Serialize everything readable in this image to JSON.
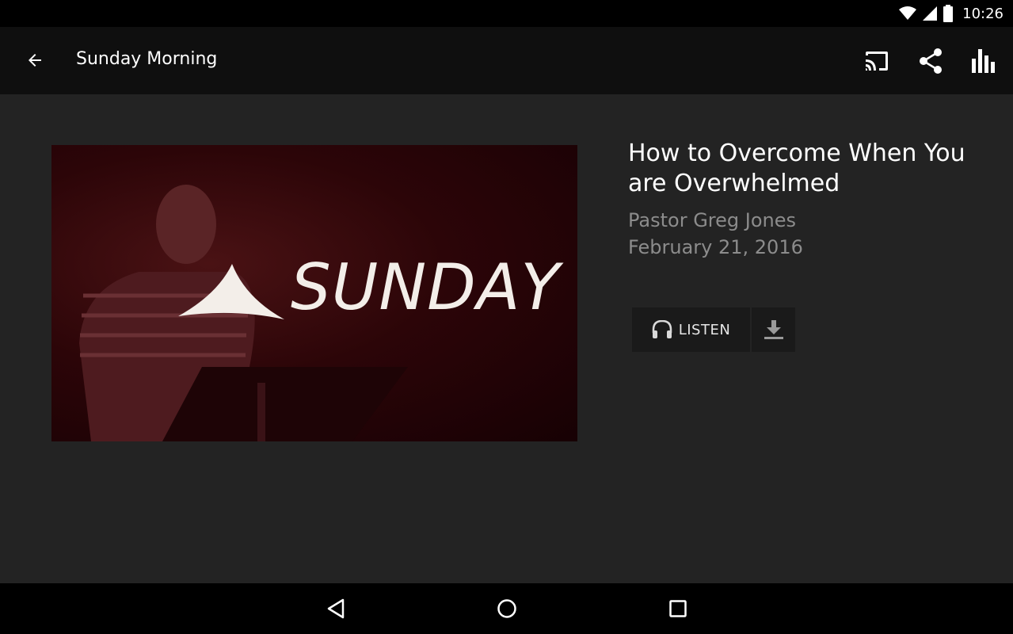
{
  "status_bar": {
    "time": "10:26"
  },
  "app_bar": {
    "title": "Sunday Morning",
    "icons": [
      "back-arrow-icon",
      "cast-icon",
      "share-icon",
      "equalizer-icon"
    ]
  },
  "sermon": {
    "artwork_text": "SUNDAY",
    "title": "How to Overcome When You are Overwhelmed",
    "speaker": "Pastor Greg Jones",
    "date": "February 21, 2016"
  },
  "media_actions": {
    "listen_label": "LISTEN"
  },
  "colors": {
    "background": "#232323",
    "app_bar": "#0f0f0f",
    "secondary_text": "#8c8c8c",
    "artwork_red": "#2c0508"
  }
}
